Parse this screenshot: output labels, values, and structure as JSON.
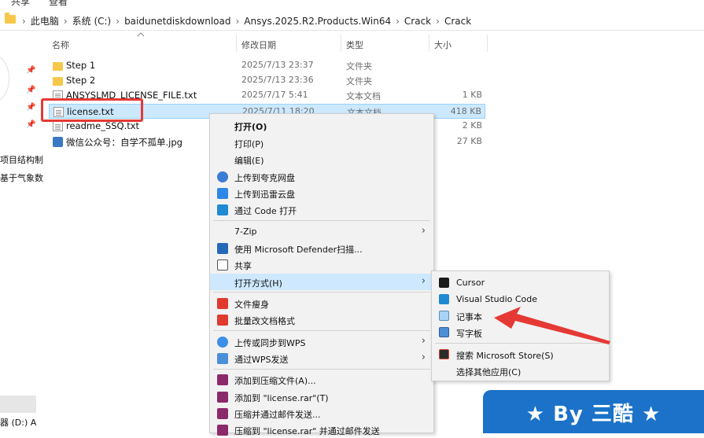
{
  "ribbon": {
    "items": [
      "共享",
      "查看"
    ]
  },
  "address": {
    "crumbs": [
      "此电脑",
      "系统 (C:)",
      "baidunetdiskdownload",
      "Ansys.2025.R2.Products.Win64",
      "Crack",
      "Crack"
    ]
  },
  "nav": {
    "items": [
      "项目结构制",
      "基于气象数",
      "器 (D:) A"
    ]
  },
  "columns": {
    "name": "名称",
    "date": "修改日期",
    "type": "类型",
    "size": "大小"
  },
  "files": [
    {
      "name": "Step 1",
      "date": "2025/7/13 23:37",
      "type": "文件夹",
      "size": "",
      "icon": "folder-icon"
    },
    {
      "name": "Step 2",
      "date": "2025/7/13 23:36",
      "type": "文件夹",
      "size": "",
      "icon": "folder-icon"
    },
    {
      "name": "ANSYSLMD_LICENSE_FILE.txt",
      "date": "2025/7/17 5:41",
      "type": "文本文档",
      "size": "1 KB",
      "icon": "text-file-icon"
    },
    {
      "name": "license.txt",
      "date": "2025/7/11 18:20",
      "type": "文本文档",
      "size": "418 KB",
      "icon": "text-file-icon"
    },
    {
      "name": "readme_SSQ.txt",
      "date": "",
      "type": "",
      "size": "2 KB",
      "icon": "text-file-icon"
    },
    {
      "name": "微信公众号：自学不孤单.jpg",
      "date": "",
      "type": "",
      "size": "27 KB",
      "icon": "image-file-icon"
    }
  ],
  "context_menu": {
    "items": [
      {
        "label": "打开(O)",
        "icon": ""
      },
      {
        "label": "打印(P)",
        "icon": ""
      },
      {
        "label": "编辑(E)",
        "icon": ""
      },
      {
        "label": "上传到夸克网盘",
        "icon": "quark-cloud-icon"
      },
      {
        "label": "上传到迅雷云盘",
        "icon": "xunlei-icon"
      },
      {
        "label": "通过 Code 打开",
        "icon": "vscode-icon"
      },
      {
        "label": "7-Zip",
        "icon": ""
      },
      {
        "label": "使用 Microsoft Defender扫描...",
        "icon": "defender-shield-icon"
      },
      {
        "label": "共享",
        "icon": "share-icon"
      },
      {
        "label": "打开方式(H)",
        "icon": ""
      },
      {
        "label": "文件瘦身",
        "icon": "wps-icon"
      },
      {
        "label": "批量改文档格式",
        "icon": "wps-icon"
      },
      {
        "label": "上传或同步到WPS",
        "icon": "wps-cloud-icon"
      },
      {
        "label": "通过WPS发送",
        "icon": "wps-send-icon"
      },
      {
        "label": "添加到压缩文件(A)...",
        "icon": "winrar-icon"
      },
      {
        "label": "添加到 \"license.rar\"(T)",
        "icon": "winrar-icon"
      },
      {
        "label": "压缩并通过邮件发送...",
        "icon": "winrar-icon"
      },
      {
        "label": "压缩到 \"license.rar\" 并通过邮件发送",
        "icon": "winrar-icon"
      }
    ]
  },
  "open_with_menu": {
    "items": [
      {
        "label": "Cursor",
        "icon": "cursor-app-icon"
      },
      {
        "label": "Visual Studio Code",
        "icon": "vscode-icon"
      },
      {
        "label": "记事本",
        "icon": "notepad-icon"
      },
      {
        "label": "写字板",
        "icon": "wordpad-icon"
      },
      {
        "label": "搜索 Microsoft Store(S)",
        "icon": "store-icon"
      },
      {
        "label": "选择其他应用(C)",
        "icon": ""
      }
    ]
  },
  "watermark": {
    "text": "★ By 三酷 ★"
  },
  "colors": {
    "selection": "#cce8ff",
    "highlight_red": "#e53935",
    "banner_blue": "#1b72c8"
  }
}
